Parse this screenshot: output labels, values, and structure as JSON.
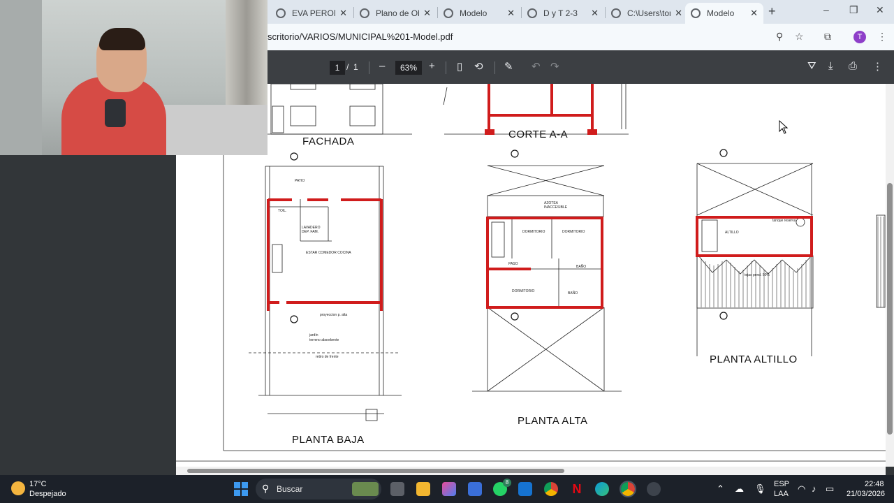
{
  "browser": {
    "tabs": [
      {
        "title": "EVA PERON 3",
        "active": false
      },
      {
        "title": "Plano de Obr",
        "active": false
      },
      {
        "title": "Modelo",
        "active": false
      },
      {
        "title": "D y T 2-3",
        "active": false
      },
      {
        "title": "C:\\Users\\tom",
        "active": false
      },
      {
        "title": "Modelo",
        "active": true
      }
    ],
    "new_tab": "+",
    "url": "scritorio/VARIOS/MUNICIPAL%201-Model.pdf",
    "profile_initial": "T",
    "window": {
      "minimize": "–",
      "restore": "❐",
      "close": "✕"
    }
  },
  "pdf_toolbar": {
    "current_page": "1",
    "page_separator": "/",
    "total_pages": "1",
    "zoom_out": "–",
    "zoom": "63%",
    "zoom_in": "+"
  },
  "drawing": {
    "labels": {
      "fachada": "FACHADA",
      "corte": "CORTE A-A",
      "planta_baja": "PLANTA BAJA",
      "planta_alta": "PLANTA ALTA",
      "planta_altillo": "PLANTA ALTILLO"
    },
    "room_labels": {
      "patio": "PATIO",
      "toil": "TOIL.",
      "lavadero": "LAVADERO",
      "dep_fam": "DEP. FAM.",
      "estar": "ESTAR COMEDOR COCINA",
      "jardin": "jardín",
      "terreno": "terreno absorbente",
      "retiro": "retiro de frente",
      "proyeccion": "proyeccion p. alta",
      "azotea": "AZOTEA",
      "inaccesible": "INACCESIBLE",
      "dormitorio_102": "DORMITORIO",
      "dormitorio_103": "DORMITORIO",
      "paso": "PASO",
      "bano_104": "BAÑO",
      "dormitorio_101": "DORMITORIO",
      "bano_105": "BAÑO",
      "altillo": "ALTILLO",
      "tanque": "tanque reserva",
      "tejas": "tejas pend. 50%"
    }
  },
  "taskbar": {
    "weather_temp": "17°C",
    "weather_desc": "Despejado",
    "search_label": "Buscar",
    "whatsapp_badge": "8",
    "lang_1": "ESP",
    "lang_2": "LAA",
    "time": "22:48",
    "date": "21/03/2026"
  },
  "colors": {
    "wall_red": "#d01c1c",
    "toolbar": "#3c3f43",
    "tabstrip": "#dfe6ee",
    "taskbar": "#1c2129"
  }
}
